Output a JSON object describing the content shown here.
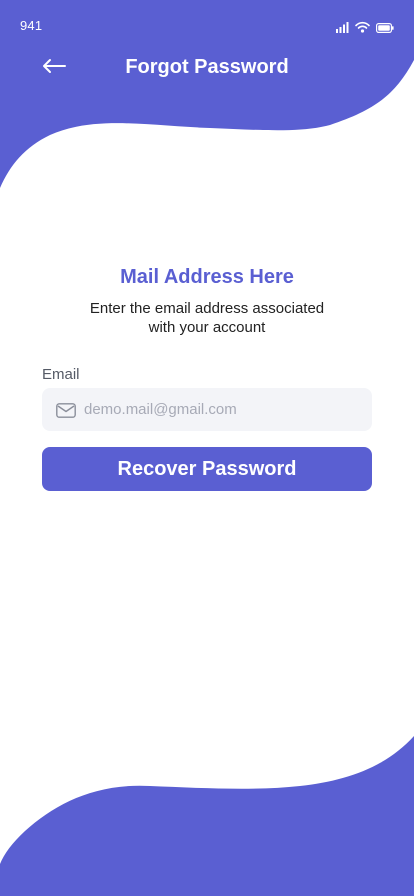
{
  "status_bar": {
    "time": "941"
  },
  "header": {
    "title": "Forgot Password"
  },
  "main": {
    "heading": "Mail Address Here",
    "subtext_line1": "Enter the email address associated",
    "subtext_line2": "with your account",
    "email_label": "Email",
    "email_placeholder": "demo.mail@gmail.com",
    "email_value": "",
    "submit_label": "Recover Password"
  },
  "colors": {
    "accent": "#5a5fd2",
    "field_bg": "#f3f4f8"
  },
  "icons": {
    "back": "arrow-left-icon",
    "mail": "mail-icon",
    "signal": "signal-icon",
    "wifi": "wifi-icon",
    "battery": "battery-icon"
  }
}
